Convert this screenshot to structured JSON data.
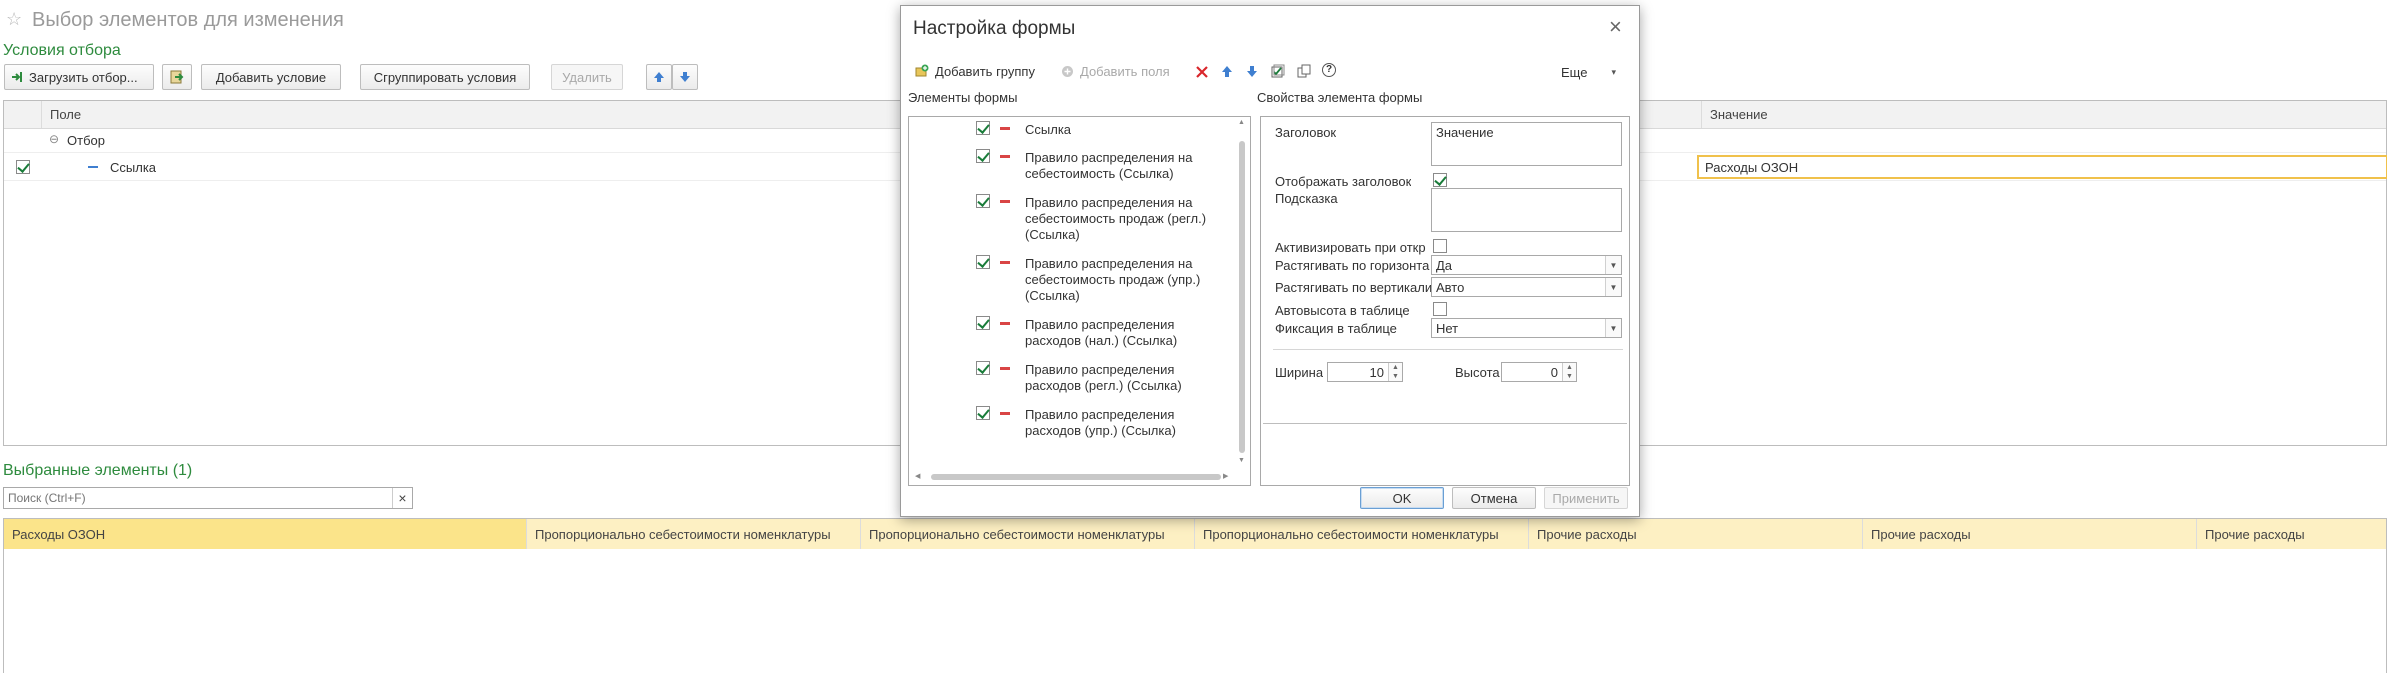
{
  "window": {
    "title": "Выбор элементов для изменения",
    "star_icon": "star-icon"
  },
  "filter_section": {
    "title": "Условия отбора",
    "buttons": {
      "load_filter": "Загрузить отбор...",
      "add_condition": "Добавить условие",
      "group_conditions": "Сгруппировать условия",
      "delete": "Удалить"
    },
    "columns": {
      "field": "Поле",
      "value": "Значение"
    },
    "rows": [
      {
        "label": "Отбор",
        "expander": "⊖"
      },
      {
        "label": "Ссылка",
        "checked": true,
        "value": "Расходы ОЗОН"
      }
    ]
  },
  "selected_section": {
    "title": "Выбранные элементы (1)",
    "search_placeholder": "Поиск (Ctrl+F)",
    "clear_glyph": "×",
    "columns": [
      "Расходы ОЗОН",
      "Пропорционально себестоимости номенклатуры",
      "Пропорционально себестоимости номенклатуры",
      "Пропорционально себестоимости номенклатуры",
      "Прочие расходы",
      "Прочие расходы",
      "Прочие расходы"
    ]
  },
  "dialog": {
    "title": "Настройка формы",
    "close_glyph": "×",
    "toolbar": {
      "add_group": "Добавить группу",
      "add_fields": "Добавить поля",
      "more": "Еще",
      "more_arrow": "▾",
      "help": "?"
    },
    "left_panel": {
      "title": "Элементы формы",
      "items": [
        {
          "text": "Ссылка"
        },
        {
          "text": "Правило распределения на себестоимость (Ссылка)"
        },
        {
          "text": "Правило распределения на себестоимость продаж (регл.) (Ссылка)"
        },
        {
          "text": "Правило распределения на себестоимость продаж (упр.) (Ссылка)"
        },
        {
          "text": "Правило распределения расходов (нал.) (Ссылка)"
        },
        {
          "text": "Правило распределения расходов (регл.) (Ссылка)"
        },
        {
          "text": "Правило распределения расходов (упр.) (Ссылка)"
        }
      ]
    },
    "right_panel": {
      "title": "Свойства элемента формы",
      "heading_label": "Заголовок",
      "heading_value": "Значение",
      "show_heading_label": "Отображать заголовок",
      "show_heading_checked": true,
      "hint_label": "Подсказка",
      "activate_label": "Активизировать при откр",
      "stretch_h_label": "Растягивать по горизонта",
      "stretch_h_value": "Да",
      "stretch_v_label": "Растягивать по вертикали",
      "stretch_v_value": "Авто",
      "autoheight_label": "Автовысота в таблице",
      "fix_label": "Фиксация в таблице",
      "fix_value": "Нет",
      "width_label": "Ширина",
      "width_value": "10",
      "height_label": "Высота",
      "height_value": "0"
    },
    "footer": {
      "ok": "OK",
      "cancel": "Отмена",
      "apply": "Применить"
    }
  },
  "colors": {
    "accent_green": "#2e8b3e",
    "selection_yellow": "#fbe48a",
    "header_yellow": "#fdf0c3",
    "focus_border": "#f0c14b"
  }
}
